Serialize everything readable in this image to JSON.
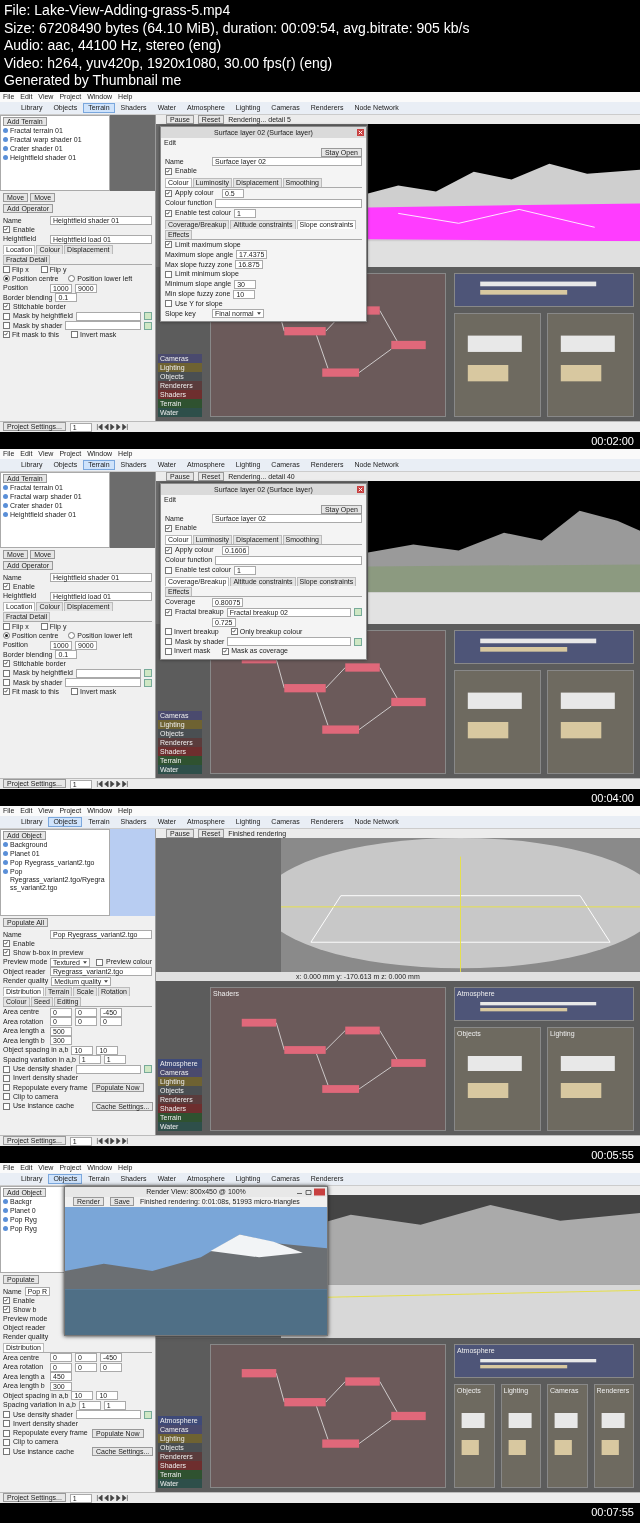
{
  "file_info": [
    "File: Lake-View-Adding-grass-5.mp4",
    "Size: 67208490 bytes (64.10 MiB), duration: 00:09:54, avg.bitrate: 905 kb/s",
    "Audio: aac, 44100 Hz, stereo (eng)",
    "Video: h264, yuv420p, 1920x1080, 30.00 fps(r) (eng)",
    "Generated by Thumbnail me"
  ],
  "frames": [
    {
      "timestamp": "00:02:00",
      "menu": [
        "File",
        "Edit",
        "View",
        "Project",
        "Window",
        "Help"
      ],
      "toolbar": [
        {
          "label": "Library",
          "selected": false
        },
        {
          "label": "Objects",
          "selected": false
        },
        {
          "label": "Terrain",
          "selected": true
        },
        {
          "label": "Shaders",
          "selected": false
        },
        {
          "label": "Water",
          "selected": false
        },
        {
          "label": "Atmosphere",
          "selected": false
        },
        {
          "label": "Lighting",
          "selected": false
        },
        {
          "label": "Cameras",
          "selected": false
        },
        {
          "label": "Renderers",
          "selected": false
        },
        {
          "label": "Node Network",
          "selected": false
        }
      ],
      "tree": {
        "add_button": "Add Terrain",
        "items": [
          "Fractal terrain 01",
          "Fractal warp shader 01",
          "Crater shader 01",
          "Heightfield shader 01"
        ],
        "footer": [
          "Move",
          "Move",
          "Add Operator"
        ]
      },
      "preview": {
        "kind": "grey"
      },
      "props": [
        {
          "kind": "field",
          "label": "Name",
          "value": "Heightfield shader 01"
        },
        {
          "kind": "check",
          "label": "Enable",
          "checked": true
        },
        {
          "kind": "field",
          "label": "Heightfield",
          "value": "Heightfield load 01"
        },
        {
          "kind": "tabs",
          "tabs": [
            {
              "label": "Location",
              "selected": true
            },
            {
              "label": "Colour",
              "selected": false
            },
            {
              "label": "Displacement",
              "selected": false
            },
            {
              "label": "Fractal Detail",
              "selected": false
            }
          ]
        },
        {
          "kind": "checks",
          "items": [
            {
              "label": "Flip x",
              "checked": false
            },
            {
              "label": "Flip y",
              "checked": false
            }
          ]
        },
        {
          "kind": "radios",
          "items": [
            {
              "label": "Position centre",
              "selected": true
            },
            {
              "label": "Position lower left",
              "selected": false
            }
          ]
        },
        {
          "kind": "number",
          "label": "Position",
          "values": [
            "1000",
            "9000"
          ]
        },
        {
          "kind": "number",
          "label": "Border blending",
          "values": [
            "0.1"
          ]
        },
        {
          "kind": "check",
          "label": "Stitchable border",
          "checked": true
        },
        {
          "kind": "fieldcheck",
          "label": "Mask by heightfield",
          "checked": false
        },
        {
          "kind": "fieldcheck",
          "label": "Mask by shader",
          "checked": false
        },
        {
          "kind": "checks",
          "items": [
            {
              "label": "Fit mask to this",
              "checked": true
            },
            {
              "label": "Invert mask",
              "checked": false
            }
          ]
        }
      ],
      "render_bar": {
        "pause": "Pause",
        "reset": "Reset",
        "status": "Rendering... detail 5"
      },
      "viewport": {
        "kind": "magenta"
      },
      "network": {
        "categories": [
          {
            "label": "Cameras",
            "color": "#4a4a6e"
          },
          {
            "label": "Lighting",
            "color": "#6e6232"
          },
          {
            "label": "Objects",
            "color": "#4a4f52"
          },
          {
            "label": "Renderers",
            "color": "#5a3c3c"
          },
          {
            "label": "Shaders",
            "color": "#6e2e2e"
          },
          {
            "label": "Terrain",
            "color": "#2f5230"
          },
          {
            "label": "Water",
            "color": "#2e4f4a"
          }
        ],
        "groups": [
          {
            "kind": "main",
            "color": "#6b5a5a"
          },
          {
            "kind": "wide",
            "color": "#4e5578"
          },
          {
            "kind": "small",
            "color": "#6e6a60"
          },
          {
            "kind": "small",
            "color": "#6e6a60"
          }
        ]
      },
      "dialog": {
        "title": "Surface layer 02   (Surface layer)",
        "menu": "Edit",
        "stay_open": "Stay Open",
        "rows": [
          {
            "kind": "field",
            "label": "Name",
            "value": "Surface layer 02"
          },
          {
            "kind": "check",
            "label": "Enable",
            "checked": true
          },
          {
            "kind": "tabs",
            "tabs": [
              {
                "label": "Colour",
                "selected": true
              },
              {
                "label": "Luminosity",
                "selected": false
              },
              {
                "label": "Displacement",
                "selected": false
              },
              {
                "label": "Smoothing",
                "selected": false
              }
            ]
          },
          {
            "kind": "number",
            "label": "Apply colour",
            "checked": true,
            "values": [
              "0.5"
            ]
          },
          {
            "kind": "field",
            "label": "Colour function"
          },
          {
            "kind": "number",
            "label": "Enable test colour",
            "checked": true,
            "values": [
              "1"
            ]
          },
          {
            "kind": "tabs",
            "tabs": [
              {
                "label": "Coverage/Breakup",
                "selected": false
              },
              {
                "label": "Altitude constraints",
                "selected": false
              },
              {
                "label": "Slope constraints",
                "selected": true
              },
              {
                "label": "Effects",
                "selected": false
              }
            ]
          },
          {
            "kind": "check",
            "label": "Limit maximum slope",
            "checked": true
          },
          {
            "kind": "number",
            "label": "Maximum slope angle",
            "values": [
              "17.4375"
            ]
          },
          {
            "kind": "number",
            "label": "Max slope fuzzy zone",
            "values": [
              "16.875"
            ]
          },
          {
            "kind": "check",
            "label": "Limit minimum slope",
            "checked": false
          },
          {
            "kind": "number",
            "label": "Minimum slope angle",
            "values": [
              "30"
            ]
          },
          {
            "kind": "number",
            "label": "Min slope fuzzy zone",
            "values": [
              "10"
            ]
          },
          {
            "kind": "check",
            "label": "Use Y for slope",
            "checked": false
          },
          {
            "kind": "select",
            "label": "Slope key",
            "value": "Final normal"
          }
        ]
      },
      "bottom": {
        "settings": "Project Settings...",
        "frame": "1"
      }
    },
    {
      "timestamp": "00:04:00",
      "menu": [
        "File",
        "Edit",
        "View",
        "Project",
        "Window",
        "Help"
      ],
      "toolbar": [
        {
          "label": "Library",
          "selected": false
        },
        {
          "label": "Objects",
          "selected": false
        },
        {
          "label": "Terrain",
          "selected": true
        },
        {
          "label": "Shaders",
          "selected": false
        },
        {
          "label": "Water",
          "selected": false
        },
        {
          "label": "Atmosphere",
          "selected": false
        },
        {
          "label": "Lighting",
          "selected": false
        },
        {
          "label": "Cameras",
          "selected": false
        },
        {
          "label": "Renderers",
          "selected": false
        },
        {
          "label": "Node Network",
          "selected": false
        }
      ],
      "tree": {
        "add_button": "Add Terrain",
        "items": [
          "Fractal terrain 01",
          "Fractal warp shader 01",
          "Crater shader 01",
          "Heightfield shader 01"
        ],
        "footer": [
          "Move",
          "Move",
          "Add Operator"
        ]
      },
      "preview": {
        "kind": "grey"
      },
      "props": [
        {
          "kind": "field",
          "label": "Name",
          "value": "Heightfield shader 01"
        },
        {
          "kind": "check",
          "label": "Enable",
          "checked": true
        },
        {
          "kind": "field",
          "label": "Heightfield",
          "value": "Heightfield load 01"
        },
        {
          "kind": "tabs",
          "tabs": [
            {
              "label": "Location",
              "selected": true
            },
            {
              "label": "Colour",
              "selected": false
            },
            {
              "label": "Displacement",
              "selected": false
            },
            {
              "label": "Fractal Detail",
              "selected": false
            }
          ]
        },
        {
          "kind": "checks",
          "items": [
            {
              "label": "Flip x",
              "checked": false
            },
            {
              "label": "Flip y",
              "checked": false
            }
          ]
        },
        {
          "kind": "radios",
          "items": [
            {
              "label": "Position centre",
              "selected": true
            },
            {
              "label": "Position lower left",
              "selected": false
            }
          ]
        },
        {
          "kind": "number",
          "label": "Position",
          "values": [
            "1000",
            "9000"
          ]
        },
        {
          "kind": "number",
          "label": "Border blending",
          "values": [
            "0.1"
          ]
        },
        {
          "kind": "check",
          "label": "Stitchable border",
          "checked": true
        },
        {
          "kind": "fieldcheck",
          "label": "Mask by heightfield",
          "checked": false
        },
        {
          "kind": "fieldcheck",
          "label": "Mask by shader",
          "checked": false
        },
        {
          "kind": "checks",
          "items": [
            {
              "label": "Fit mask to this",
              "checked": true
            },
            {
              "label": "Invert mask",
              "checked": false
            }
          ]
        }
      ],
      "render_bar": {
        "pause": "Pause",
        "reset": "Reset",
        "status": "Rendering... detail 40"
      },
      "viewport": {
        "kind": "grey_terrain"
      },
      "network": {
        "categories": [
          {
            "label": "Cameras",
            "color": "#4a4a6e"
          },
          {
            "label": "Lighting",
            "color": "#6e6232"
          },
          {
            "label": "Objects",
            "color": "#4a4f52"
          },
          {
            "label": "Renderers",
            "color": "#5a3c3c"
          },
          {
            "label": "Shaders",
            "color": "#6e2e2e"
          },
          {
            "label": "Terrain",
            "color": "#2f5230"
          },
          {
            "label": "Water",
            "color": "#2e4f4a"
          }
        ],
        "groups": [
          {
            "kind": "main",
            "color": "#6b5a5a"
          },
          {
            "kind": "wide",
            "color": "#4e5578"
          },
          {
            "kind": "small",
            "color": "#6e6a60"
          },
          {
            "kind": "small",
            "color": "#6e6a60"
          }
        ]
      },
      "dialog": {
        "title": "Surface layer 02   (Surface layer)",
        "menu": "Edit",
        "stay_open": "Stay Open",
        "rows": [
          {
            "kind": "field",
            "label": "Name",
            "value": "Surface layer 02"
          },
          {
            "kind": "check",
            "label": "Enable",
            "checked": true
          },
          {
            "kind": "tabs",
            "tabs": [
              {
                "label": "Colour",
                "selected": true
              },
              {
                "label": "Luminosity",
                "selected": false
              },
              {
                "label": "Displacement",
                "selected": false
              },
              {
                "label": "Smoothing",
                "selected": false
              }
            ]
          },
          {
            "kind": "number",
            "label": "Apply colour",
            "checked": true,
            "values": [
              "0.1606"
            ]
          },
          {
            "kind": "field",
            "label": "Colour function"
          },
          {
            "kind": "number",
            "label": "Enable test colour",
            "checked": false,
            "values": [
              "1"
            ]
          },
          {
            "kind": "tabs",
            "tabs": [
              {
                "label": "Coverage/Breakup",
                "selected": true
              },
              {
                "label": "Altitude constraints",
                "selected": false
              },
              {
                "label": "Slope constraints",
                "selected": false
              },
              {
                "label": "Effects",
                "selected": false
              }
            ]
          },
          {
            "kind": "number",
            "label": "Coverage",
            "values": [
              "0.80075"
            ]
          },
          {
            "kind": "fieldcheck",
            "label": "Fractal breakup",
            "checked": true,
            "value": "Fractal breakup 02"
          },
          {
            "kind": "number",
            "values": [
              "0.725"
            ]
          },
          {
            "kind": "checks",
            "items": [
              {
                "label": "Invert breakup",
                "checked": false
              },
              {
                "label": "Only breakup colour",
                "checked": true
              }
            ]
          },
          {
            "kind": "fieldcheck",
            "label": "Mask by shader",
            "checked": false
          },
          {
            "kind": "checks",
            "items": [
              {
                "label": "Invert mask",
                "checked": false
              },
              {
                "label": "Mask as coverage",
                "checked": true
              }
            ]
          }
        ]
      },
      "bottom": {
        "settings": "Project Settings...",
        "frame": "1"
      }
    },
    {
      "timestamp": "00:05:55",
      "menu": [
        "File",
        "Edit",
        "View",
        "Project",
        "Window",
        "Help"
      ],
      "toolbar": [
        {
          "label": "Library",
          "selected": false
        },
        {
          "label": "Objects",
          "selected": true
        },
        {
          "label": "Terrain",
          "selected": false
        },
        {
          "label": "Shaders",
          "selected": false
        },
        {
          "label": "Water",
          "selected": false
        },
        {
          "label": "Atmosphere",
          "selected": false
        },
        {
          "label": "Lighting",
          "selected": false
        },
        {
          "label": "Cameras",
          "selected": false
        },
        {
          "label": "Renderers",
          "selected": false
        },
        {
          "label": "Node Network",
          "selected": false
        }
      ],
      "tree": {
        "add_button": "Add Object",
        "items": [
          "Background",
          "Planet 01",
          "Pop Ryegrass_variant2.tgo",
          "Pop Ryegrass_variant2.tgo/Ryegrass_variant2.tgo"
        ],
        "footer": [
          "Populate All"
        ]
      },
      "preview": {
        "kind": "blue"
      },
      "props": [
        {
          "kind": "field",
          "label": "Name",
          "value": "Pop Ryegrass_variant2.tgo"
        },
        {
          "kind": "check",
          "label": "Enable",
          "checked": true
        },
        {
          "kind": "check",
          "label": "Show b-box in preview",
          "checked": true
        },
        {
          "kind": "select",
          "label": "Preview mode",
          "value": "Textured",
          "check": {
            "label": "Preview colour",
            "checked": false
          }
        },
        {
          "kind": "field",
          "label": "Object reader",
          "value": "Ryegrass_variant2.tgo"
        },
        {
          "kind": "select",
          "label": "Render quality",
          "value": "Medium quality"
        },
        {
          "kind": "tabs",
          "tabs": [
            {
              "label": "Distribution",
              "selected": true
            },
            {
              "label": "Terrain",
              "selected": false
            },
            {
              "label": "Scale",
              "selected": false
            },
            {
              "label": "Rotation",
              "selected": false
            },
            {
              "label": "Colour",
              "selected": false
            },
            {
              "label": "Seed",
              "selected": false
            },
            {
              "label": "Editing",
              "selected": false
            }
          ]
        },
        {
          "kind": "number",
          "label": "Area centre",
          "values": [
            "0",
            "0",
            "-450"
          ]
        },
        {
          "kind": "number",
          "label": "Area rotation",
          "values": [
            "0",
            "0",
            "0"
          ]
        },
        {
          "kind": "number",
          "label": "Area length a",
          "values": [
            "500"
          ]
        },
        {
          "kind": "number",
          "label": "Area length b",
          "values": [
            "300"
          ]
        },
        {
          "kind": "number",
          "label": "Object spacing in a,b",
          "values": [
            "10",
            "10"
          ]
        },
        {
          "kind": "number",
          "label": "Spacing variation in a,b",
          "values": [
            "1",
            "1"
          ]
        },
        {
          "kind": "fieldcheck",
          "label": "Use density shader",
          "checked": false
        },
        {
          "kind": "check",
          "label": "Invert density shader",
          "checked": false
        },
        {
          "kind": "check",
          "label": "Repopulate every frame",
          "checked": false,
          "button": "Populate Now"
        },
        {
          "kind": "check",
          "label": "Clip to camera",
          "checked": false
        },
        {
          "kind": "check",
          "label": "Use instance cache",
          "checked": false,
          "button": "Cache Settings..."
        }
      ],
      "render_bar": {
        "pause": "Pause",
        "reset": "Reset",
        "status": "Finished rendering"
      },
      "viewport": {
        "kind": "dish",
        "readout": "x: 0.000 mm   y: -170.613 m   z: 0.000 mm"
      },
      "network": {
        "categories": [
          {
            "label": "Atmosphere",
            "color": "#3f4a78"
          },
          {
            "label": "Cameras",
            "color": "#4a4a6e"
          },
          {
            "label": "Lighting",
            "color": "#6e6232"
          },
          {
            "label": "Objects",
            "color": "#4a4f52"
          },
          {
            "label": "Renderers",
            "color": "#5a3c3c"
          },
          {
            "label": "Shaders",
            "color": "#6e2e2e"
          },
          {
            "label": "Terrain",
            "color": "#2f5230"
          },
          {
            "label": "Water",
            "color": "#2e4f4a"
          }
        ],
        "groups": [
          {
            "kind": "main",
            "title": "Shaders",
            "color": "#6b5a5a"
          },
          {
            "kind": "wide",
            "title": "Atmosphere",
            "color": "#4e5578"
          },
          {
            "kind": "small",
            "title": "Objects",
            "color": "#6e6a60"
          },
          {
            "kind": "small",
            "title": "Lighting",
            "color": "#6e6a60"
          }
        ]
      },
      "bottom": {
        "settings": "Project Settings...",
        "frame": "1"
      }
    },
    {
      "timestamp": "00:07:55",
      "menu": [
        "File",
        "Edit",
        "View",
        "Project",
        "Window",
        "Help"
      ],
      "toolbar": [
        {
          "label": "Library",
          "selected": false
        },
        {
          "label": "Objects",
          "selected": true
        },
        {
          "label": "Terrain",
          "selected": false
        },
        {
          "label": "Shaders",
          "selected": false
        },
        {
          "label": "Water",
          "selected": false
        },
        {
          "label": "Atmosphere",
          "selected": false
        },
        {
          "label": "Lighting",
          "selected": false
        },
        {
          "label": "Cameras",
          "selected": false
        },
        {
          "label": "Renderers",
          "selected": false
        }
      ],
      "tree": {
        "add_button": "Add Object",
        "items": [
          "Backgr",
          "Planet 0",
          "Pop Ryg",
          "Pop Ryg"
        ],
        "footer": [
          "Populate"
        ]
      },
      "preview": {
        "kind": "grey"
      },
      "props": [
        {
          "kind": "cutfield",
          "label": "Name",
          "value": "Pop R"
        },
        {
          "kind": "check",
          "label": "Enable",
          "checked": true
        },
        {
          "kind": "check",
          "label": "Show b",
          "checked": true
        },
        {
          "kind": "label",
          "label": "Preview mode"
        },
        {
          "kind": "label",
          "label": "Object reader"
        },
        {
          "kind": "label",
          "label": "Render quality"
        },
        {
          "kind": "tabs",
          "tabs": [
            {
              "label": "Distribution",
              "selected": true
            }
          ]
        },
        {
          "kind": "number",
          "label": "Area centre",
          "values": [
            "0",
            "0",
            "-450"
          ]
        },
        {
          "kind": "number",
          "label": "Area rotation",
          "values": [
            "0",
            "0",
            "0"
          ]
        },
        {
          "kind": "number",
          "label": "Area length a",
          "values": [
            "450"
          ]
        },
        {
          "kind": "number",
          "label": "Area length b",
          "values": [
            "300"
          ]
        },
        {
          "kind": "number",
          "label": "Object spacing in a,b",
          "values": [
            "10",
            "10"
          ]
        },
        {
          "kind": "number",
          "label": "Spacing variation in a,b",
          "values": [
            "1",
            "1"
          ]
        },
        {
          "kind": "fieldcheck",
          "label": "Use density shader",
          "checked": false
        },
        {
          "kind": "check",
          "label": "Invert density shader",
          "checked": false
        },
        {
          "kind": "check",
          "label": "Repopulate every frame",
          "checked": false,
          "button": "Populate Now"
        },
        {
          "kind": "check",
          "label": "Clip to camera",
          "checked": false
        },
        {
          "kind": "check",
          "label": "Use instance cache",
          "checked": false,
          "button": "Cache Settings..."
        }
      ],
      "viewport": {
        "kind": "grey_mesh"
      },
      "network": {
        "categories": [
          {
            "label": "Atmosphere",
            "color": "#3f4a78"
          },
          {
            "label": "Cameras",
            "color": "#4a4a6e"
          },
          {
            "label": "Lighting",
            "color": "#6e6232"
          },
          {
            "label": "Objects",
            "color": "#4a4f52"
          },
          {
            "label": "Renderers",
            "color": "#5a3c3c"
          },
          {
            "label": "Shaders",
            "color": "#6e2e2e"
          },
          {
            "label": "Terrain",
            "color": "#2f5230"
          },
          {
            "label": "Water",
            "color": "#2e4f4a"
          }
        ],
        "groups": [
          {
            "kind": "main",
            "color": "#6b5a5a"
          },
          {
            "kind": "wide",
            "title": "Atmosphere",
            "color": "#4e5578"
          },
          {
            "kind": "small",
            "title": "Objects",
            "color": "#6e6a60"
          },
          {
            "kind": "small",
            "title": "Lighting",
            "color": "#6e6a60"
          },
          {
            "kind": "small",
            "title": "Cameras",
            "color": "#6e6a60"
          },
          {
            "kind": "small",
            "title": "Renderers",
            "color": "#6e6a60"
          }
        ]
      },
      "render_window": {
        "title": "Render View: 800x450 @ 100%",
        "render": "Render",
        "save": "Save",
        "status": "Finished rendering: 0:01:08s, 51993 micro-triangles"
      },
      "bottom": {
        "settings": "Project Settings...",
        "frame": "1"
      }
    }
  ]
}
